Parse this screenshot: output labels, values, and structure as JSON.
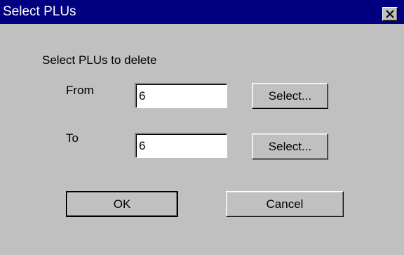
{
  "window": {
    "title": "Select PLUs",
    "close_glyph": "✕"
  },
  "form": {
    "heading": "Select PLUs to delete",
    "from_label": "From",
    "from_value": "6",
    "to_label": "To",
    "to_value": "6",
    "select_label": "Select..."
  },
  "buttons": {
    "ok": "OK",
    "cancel": "Cancel"
  },
  "colors": {
    "titlebar": "#000080",
    "face": "#c0c0c0"
  },
  "icons": {
    "close": "close-icon"
  }
}
